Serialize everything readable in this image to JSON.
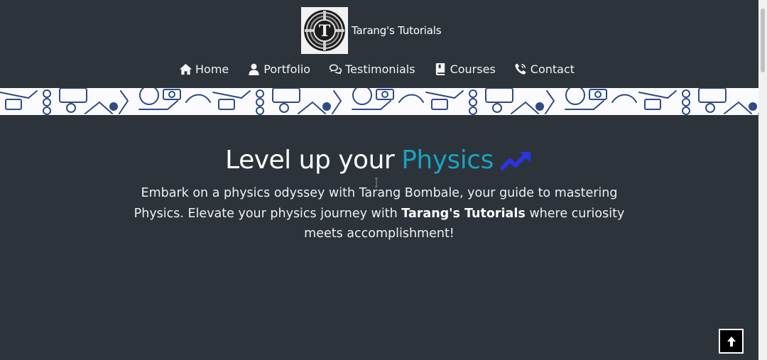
{
  "brand": {
    "name": "Tarang's Tutorials",
    "logo_letter": "T"
  },
  "nav": {
    "items": [
      {
        "label": "Home",
        "icon": "home-icon"
      },
      {
        "label": "Portfolio",
        "icon": "user-icon"
      },
      {
        "label": "Testimonials",
        "icon": "chat-bubbles-icon"
      },
      {
        "label": "Courses",
        "icon": "book-icon"
      },
      {
        "label": "Contact",
        "icon": "phone-icon"
      }
    ]
  },
  "hero": {
    "title_prefix": "Level up your",
    "title_accent": "Physics",
    "title_icon": "trending-up-icon",
    "text_before": "Embark on a physics odyssey with Tarang Bombale, your guide to mastering Physics. Elevate your physics journey with",
    "text_bold": "Tarang's Tutorials",
    "text_after": "where curiosity meets accomplishment!"
  },
  "back_to_top": {
    "icon": "arrow-up-icon"
  },
  "colors": {
    "background": "#2d333b",
    "accent": "#17a3bf",
    "trend_icon": "#2b34e0",
    "banner": "#fbfbfd",
    "banner_doodles": "#2f4a86"
  }
}
